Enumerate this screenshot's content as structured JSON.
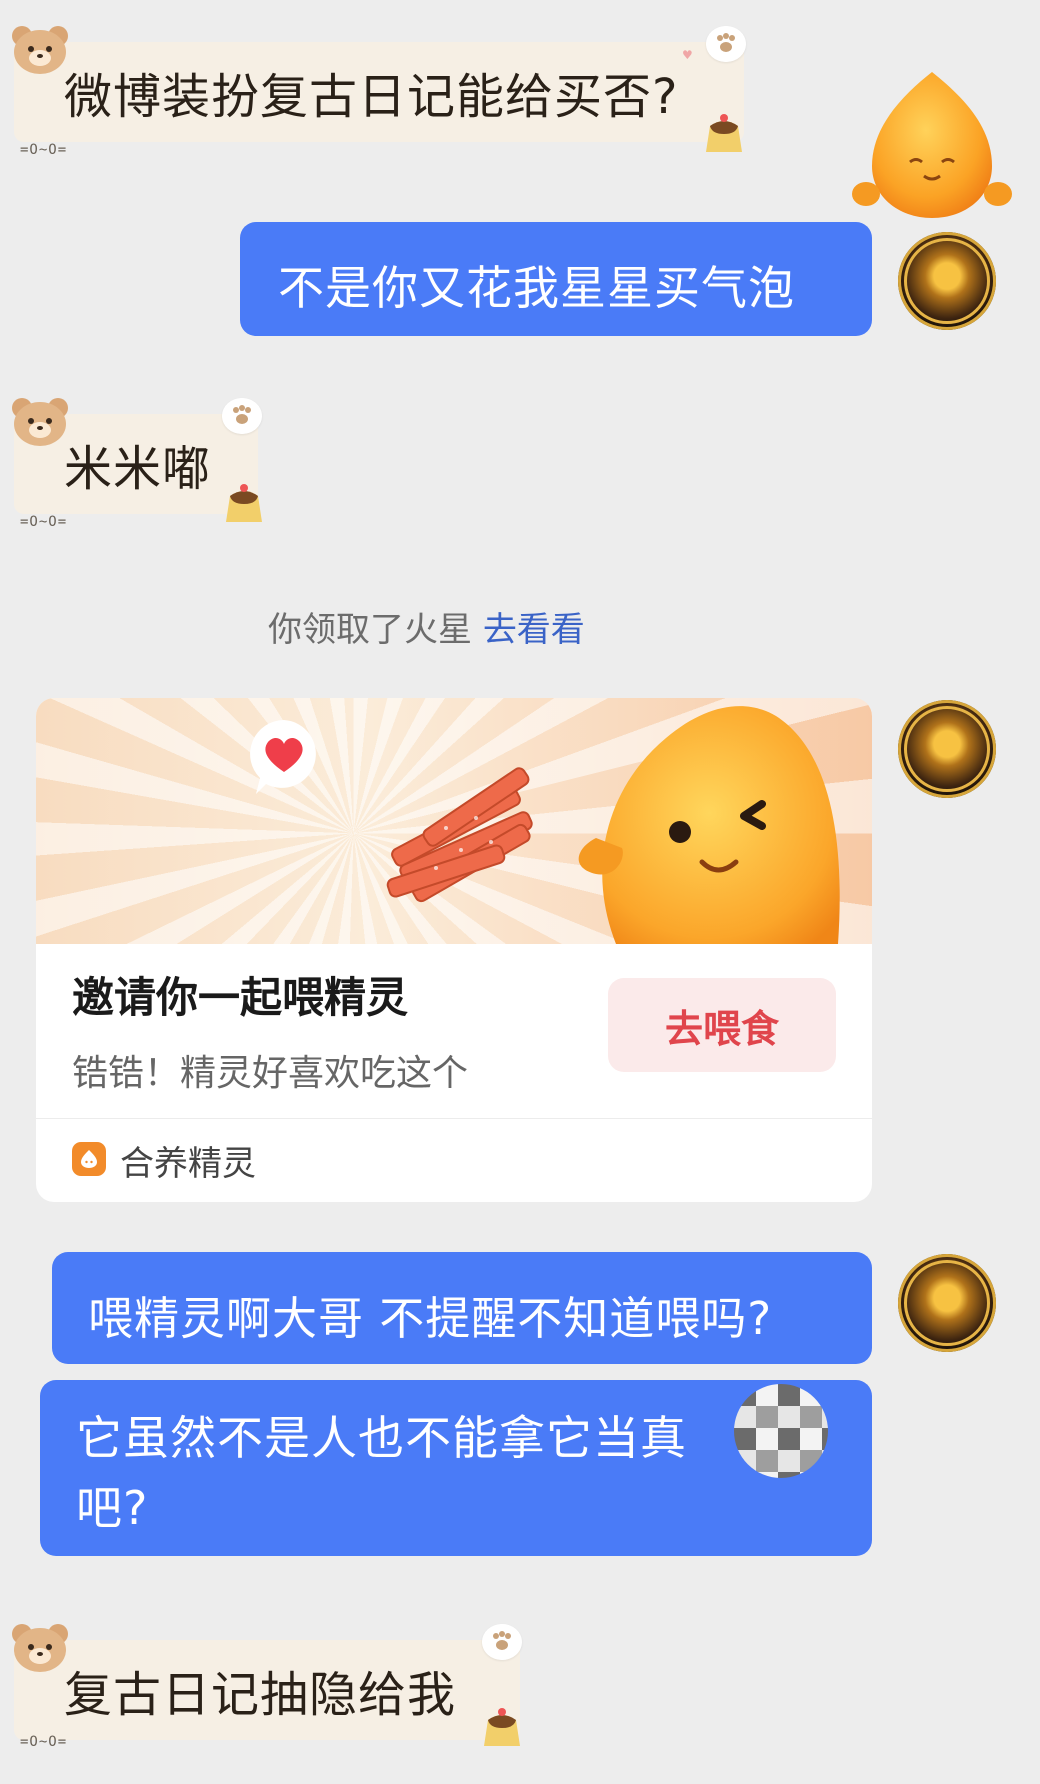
{
  "messages": {
    "m1": {
      "text": "微博装扮复古日记能给买否?",
      "deco_tag": "=O~O="
    },
    "m2": {
      "text": "不是你又花我星星买气泡"
    },
    "m3": {
      "text": "米米嘟",
      "deco_tag": "=O~O="
    },
    "system": {
      "text": "你领取了火星",
      "link": "去看看"
    },
    "card": {
      "title": "邀请你一起喂精灵",
      "subtitle": "锆锆！精灵好喜欢吃这个",
      "button_label": "去喂食",
      "app_name": "合养精灵"
    },
    "m5": {
      "text": "喂精灵啊大哥 不提醒不知道喂吗?"
    },
    "m6": {
      "line1": "它虽然不是人也不能拿它当真",
      "line2": "吧?"
    },
    "m7": {
      "text": "复古日记抽隐给我",
      "deco_tag": "=O~O="
    }
  },
  "colors": {
    "bubble_blue": "#4a7bf7",
    "deco_bubble_bg": "#f6efe4",
    "link_blue": "#3a63c7",
    "feed_button_text": "#e0454c",
    "page_bg": "#ededed"
  },
  "icons": [
    "bear-sticker-icon",
    "paw-icon",
    "pudding-icon",
    "mascot-icon",
    "heart-icon",
    "spirit-app-icon"
  ]
}
